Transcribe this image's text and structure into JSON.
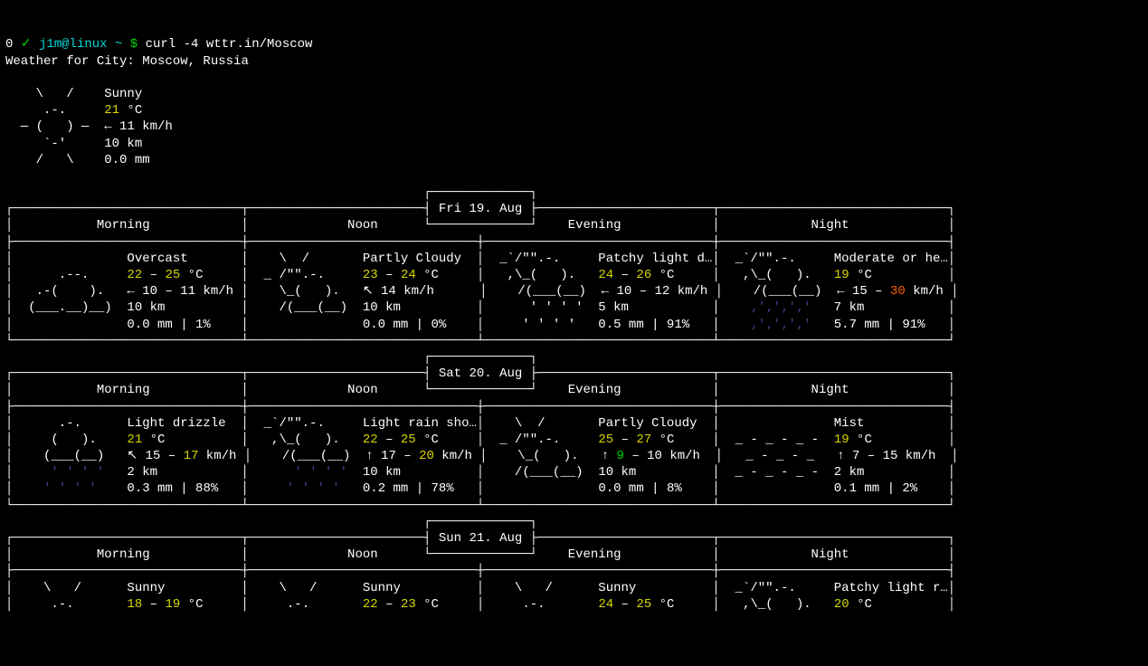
{
  "prompt": {
    "status": "0",
    "check": "✓",
    "user": "j1m@linux",
    "tilde": "~",
    "dollar": "$",
    "command": "curl -4 wttr.in/Moscow"
  },
  "location_line": "Weather for City: Moscow, Russia",
  "current": {
    "art": [
      "    \\   /    ",
      "     .-.     ",
      "  ― (   ) ―  ",
      "     `-'     ",
      "    /   \\    "
    ],
    "desc": "Sunny",
    "temp_pre": "",
    "temp": "21",
    "temp_unit": " °C",
    "wind_dir": "←",
    "wind": " 11 km/h",
    "vis": "10 km",
    "precip": "0.0 mm"
  },
  "days": [
    {
      "date": "Fri 19. Aug",
      "cells": [
        {
          "label": "Morning",
          "art_plain": true,
          "art": [
            "             ",
            "     .--.    ",
            "  .-(    ).  ",
            " (___.__)__) ",
            "             "
          ],
          "desc": "Overcast",
          "t1": "22",
          "t2": "25",
          "wdir": "←",
          "w1": " 10",
          "w2": "11",
          "wunit": " km/h",
          "vis": "10 km",
          "precip": "0.0 mm | 1%"
        },
        {
          "label": "Noon",
          "art_plain": true,
          "art": [
            "   \\  /       ",
            " _ /\"\".-.    ",
            "   \\_(   ).  ",
            "   /(___(__) ",
            "             "
          ],
          "desc": "Partly Cloudy",
          "t1": "23",
          "t2": "24",
          "wdir": "↖",
          "w1": " 14",
          "w2": "",
          "wunit": " km/h",
          "vis": "10 km",
          "precip": "0.0 mm | 0%"
        },
        {
          "label": "Evening",
          "art_plain": true,
          "art": [
            " _`/\"\".-.    ",
            "  ,\\_(   ).  ",
            "   /(___(__) ",
            "     ' ' ' ' ",
            "    ' ' ' '  "
          ],
          "desc": "Patchy light d…",
          "t1": "24",
          "t2": "26",
          "t2_color": "y",
          "wdir": "←",
          "w1": " 10",
          "w2": "12",
          "wunit": " km/h",
          "vis": "5 km",
          "precip": "0.5 mm | 91%"
        },
        {
          "label": "Night",
          "art_plain": false,
          "art": [
            " _`/\"\".-.    ",
            "  ,\\_(   ).  ",
            "   /(___(__) "
          ],
          "rain": [
            "   ‚'‚'‚'‚'  ",
            "   ‚'‚'‚'‚'  "
          ],
          "desc": "Moderate or he…",
          "t1": "19",
          "t2": "",
          "wdir": "←",
          "w1": " 15",
          "w2": "30",
          "w2_color": "r",
          "wunit": " km/h",
          "vis": "7 km",
          "precip": "5.7 mm | 91%"
        }
      ]
    },
    {
      "date": "Sat 20. Aug",
      "cells": [
        {
          "label": "Morning",
          "art_plain": false,
          "art": [
            "     .-.     ",
            "    (   ).   ",
            "   (___(__)  "
          ],
          "rain": [
            "    ' ' ' '  ",
            "   ' ' ' '   "
          ],
          "desc": "Light drizzle",
          "t1": "21",
          "t2": "",
          "wdir": "↖",
          "w1": " 15",
          "w2": "17",
          "w2_color": "y",
          "wunit": " km/h",
          "vis": "2 km",
          "precip": "0.3 mm | 88%"
        },
        {
          "label": "Noon",
          "art_plain": false,
          "art": [
            " _`/\"\".-.    ",
            "  ,\\_(   ).  ",
            "   /(___(__) "
          ],
          "rain": [
            "     ' ' ' ' ",
            "    ' ' ' '  "
          ],
          "desc": "Light rain sho…",
          "t1": "22",
          "t2": "25",
          "t2_color": "y",
          "wdir": "↑",
          "w1": " 17",
          "w2": "20",
          "w2_color": "y",
          "wunit": " km/h",
          "vis": "10 km",
          "precip": "0.2 mm | 78%"
        },
        {
          "label": "Evening",
          "art_plain": true,
          "art": [
            "   \\  /       ",
            " _ /\"\".-.    ",
            "   \\_(   ).  ",
            "   /(___(__) ",
            "             "
          ],
          "desc": "Partly Cloudy",
          "t1": "25",
          "t1_color": "y",
          "t2": "27",
          "t2_color": "y",
          "wdir": "↑",
          "w1": " 9",
          "w1_color": "g",
          "w2": "10",
          "wunit": " km/h",
          "vis": "10 km",
          "precip": "0.0 mm | 8%"
        },
        {
          "label": "Night",
          "art_plain": true,
          "art": [
            "             ",
            " _ - _ - _ - ",
            "  _ - _ - _  ",
            " _ - _ - _ - ",
            "             "
          ],
          "desc": "Mist",
          "t1": "19",
          "t2": "",
          "wdir": "↑",
          "w1": " 7",
          "w2": "15",
          "wunit": " km/h",
          "vis": "2 km",
          "precip": "0.1 mm | 2%"
        }
      ]
    },
    {
      "date": "Sun 21. Aug",
      "compact": true,
      "cells": [
        {
          "label": "Morning",
          "art_plain": true,
          "art": [
            "   \\   /     ",
            "    .-.      "
          ],
          "desc": "Sunny",
          "t1": "18",
          "t2": "19"
        },
        {
          "label": "Noon",
          "art_plain": true,
          "art": [
            "   \\   /     ",
            "    .-.      "
          ],
          "desc": "Sunny",
          "t1": "22",
          "t2": "23"
        },
        {
          "label": "Evening",
          "art_plain": true,
          "art": [
            "   \\   /     ",
            "    .-.      "
          ],
          "desc": "Sunny",
          "t1": "24",
          "t2": "25",
          "t2_color": "y"
        },
        {
          "label": "Night",
          "art_plain": true,
          "art": [
            " _`/\"\".-.    ",
            "  ,\\_(   ).  "
          ],
          "desc": "Patchy light r…",
          "t1": "20",
          "t2": ""
        }
      ]
    }
  ]
}
